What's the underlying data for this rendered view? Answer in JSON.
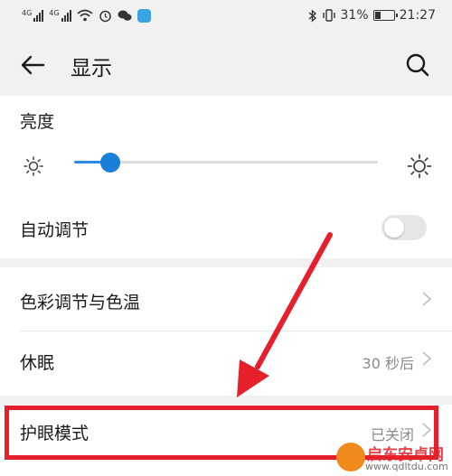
{
  "status_bar": {
    "network_1": "4G",
    "network_2": "4G",
    "battery_percent": "31%",
    "battery_level": 0.31,
    "time": "21:27"
  },
  "header": {
    "title": "显示"
  },
  "brightness": {
    "title": "亮度",
    "level": 0.12,
    "accent_color": "#1a7fd9"
  },
  "auto_adjust": {
    "label": "自动调节",
    "enabled": false
  },
  "color_temp": {
    "label": "色彩调节与色温"
  },
  "sleep": {
    "label": "休眠",
    "value": "30 秒后"
  },
  "eye_comfort": {
    "label": "护眼模式",
    "value": "已关闭"
  },
  "annotation": {
    "color": "#e5202b"
  },
  "watermark": {
    "name": "启东安卓网",
    "url": "www.qdltdu.com"
  }
}
